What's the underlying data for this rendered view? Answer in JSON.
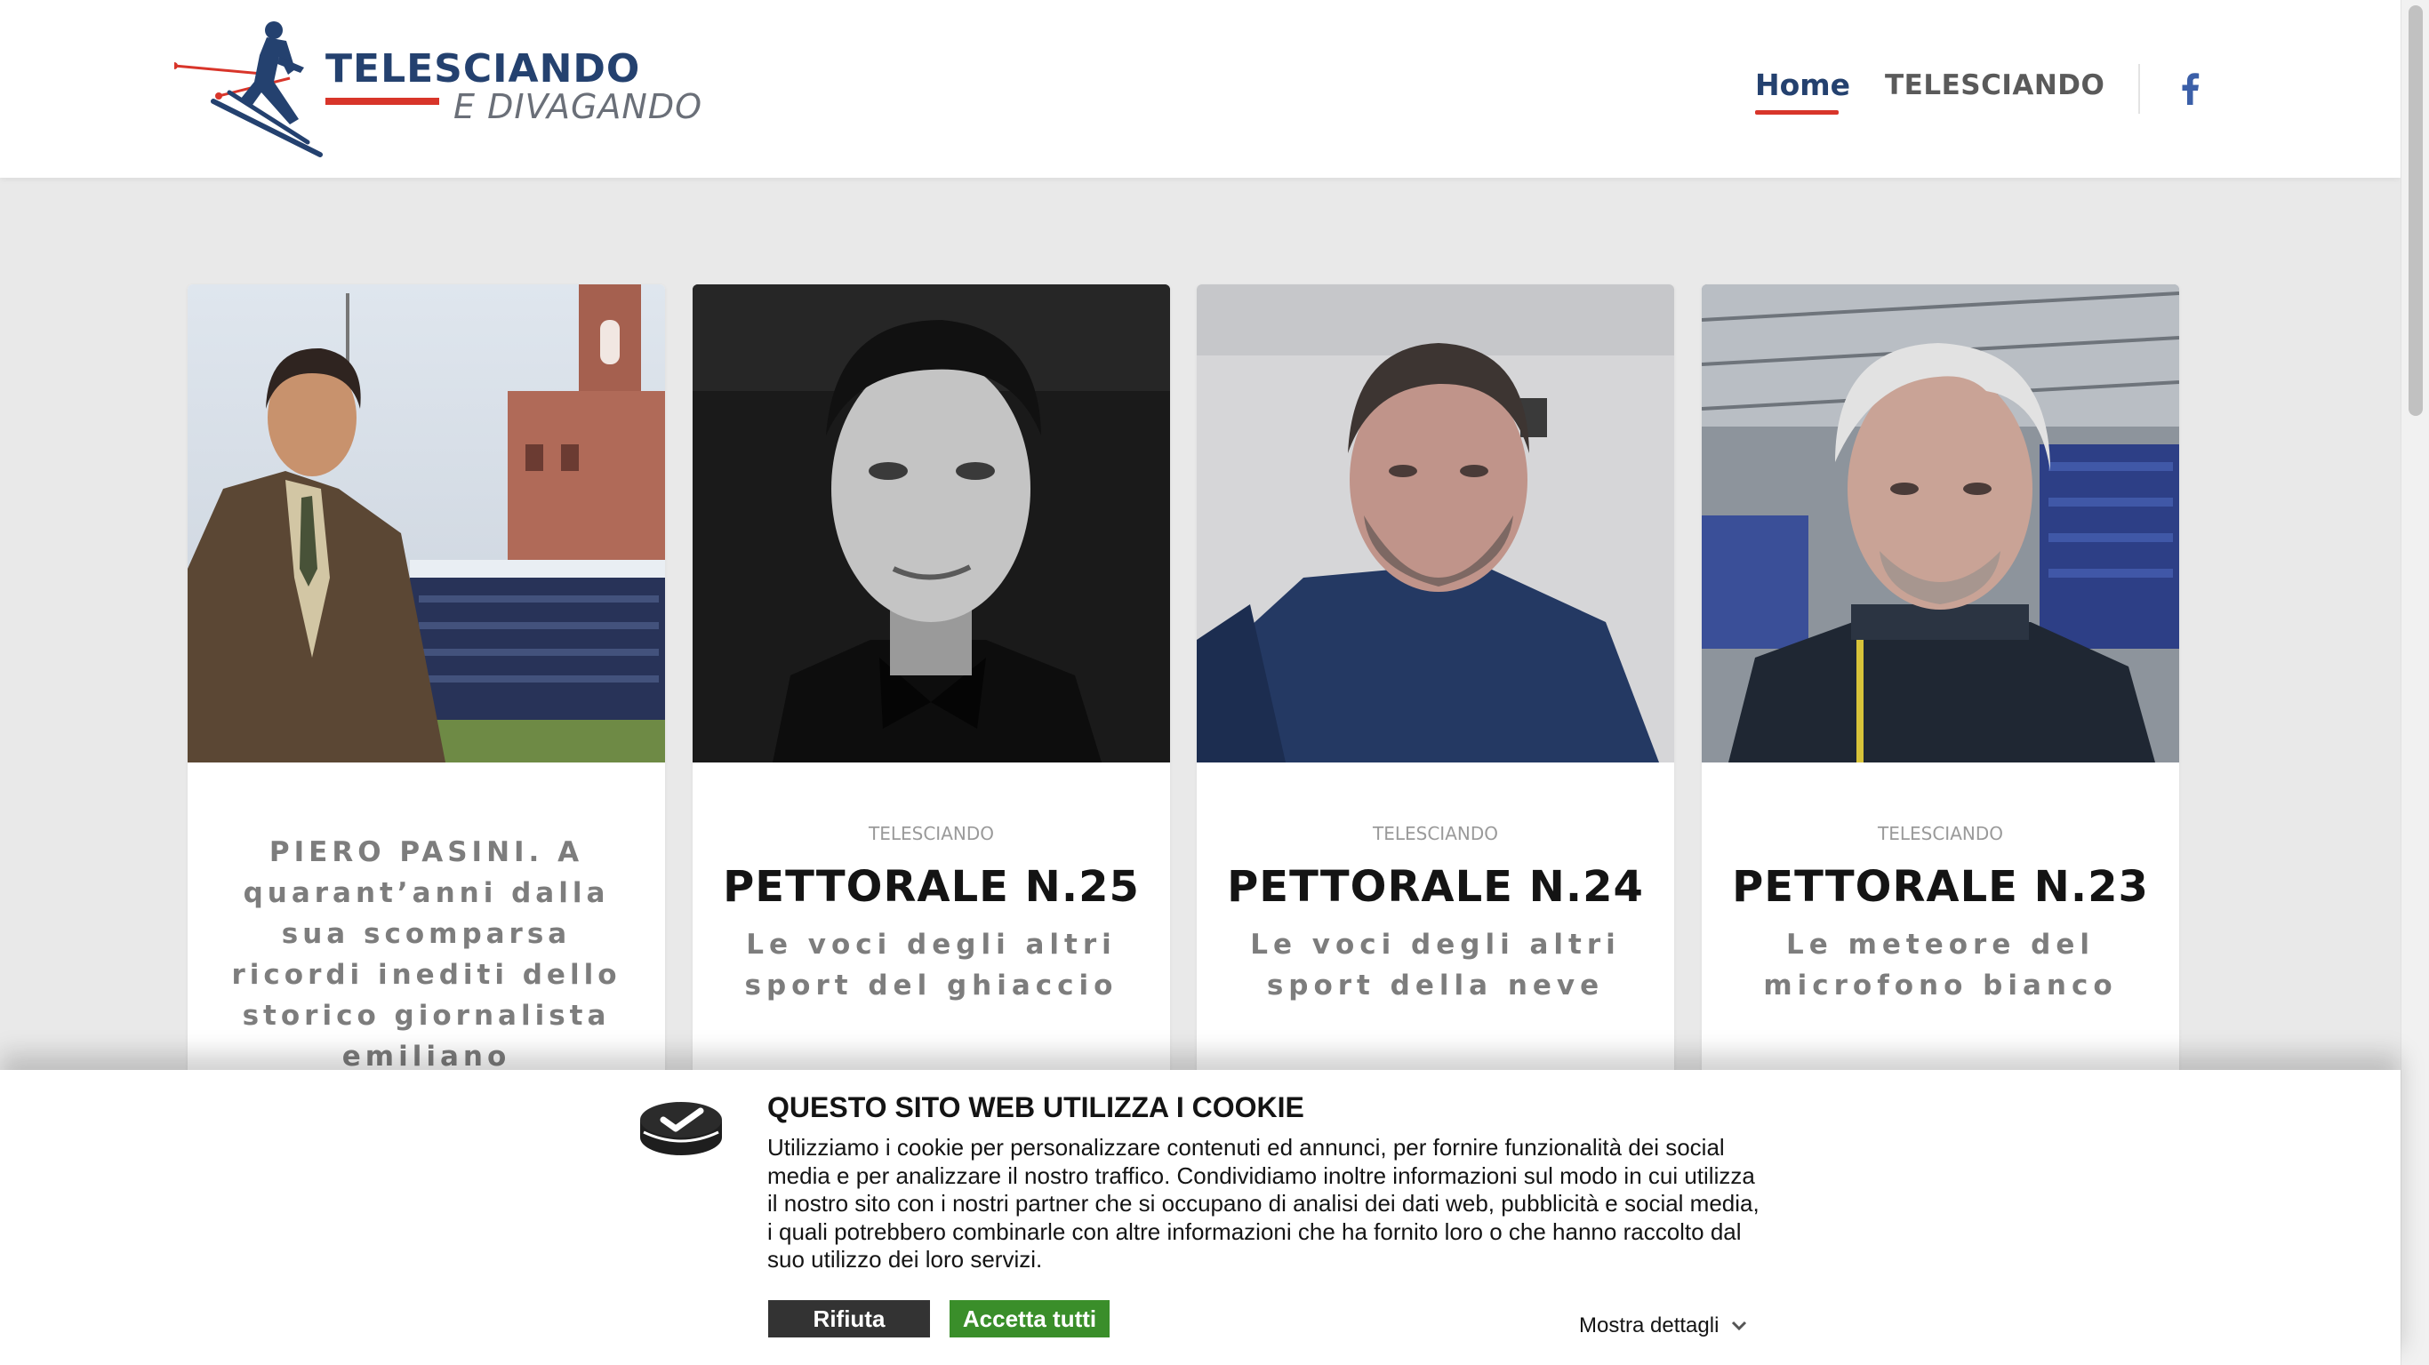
{
  "header": {
    "logo_title": "TELESCIANDO",
    "logo_subtitle": "E DIVAGANDO",
    "nav": [
      {
        "label": "Home",
        "active": true
      },
      {
        "label": "TELESCIANDO",
        "active": false
      }
    ],
    "social_icon": "facebook-icon"
  },
  "cards": [
    {
      "category": "",
      "title": "",
      "subtitle": "PIERO PASINI. A quarant’anni dalla sua scomparsa ricordi inediti dello storico giornalista emiliano",
      "image": "tv-presenter-in-stadium-photo"
    },
    {
      "category": "TELESCIANDO",
      "title": "PETTORALE N.25",
      "subtitle": "Le voci degli altri sport del ghiaccio",
      "image": "black-and-white-portrait-photo"
    },
    {
      "category": "TELESCIANDO",
      "title": "PETTORALE N.24",
      "subtitle": "Le voci degli altri sport della neve",
      "image": "webcam-portrait-photo"
    },
    {
      "category": "TELESCIANDO",
      "title": "PETTORALE N.23",
      "subtitle": "Le meteore del microfono bianco",
      "image": "stadium-selfie-photo"
    }
  ],
  "cookie_banner": {
    "title": "QUESTO SITO WEB UTILIZZA I COOKIE",
    "text": "Utilizziamo i cookie per personalizzare contenuti ed annunci, per fornire funzionalità dei social media e per analizzare il nostro traffico. Condividiamo inoltre informazioni sul modo in cui utilizza il nostro sito con i nostri partner che si occupano di analisi dei dati web, pubblicità e social media, i quali potrebbero combinarle con altre informazioni che ha fornito loro o che hanno raccolto dal suo utilizzo dei loro servizi.",
    "reject_label": "Rifiuta",
    "accept_label": "Accetta tutti",
    "details_label": "Mostra dettagli",
    "colors": {
      "reject": "#333333",
      "accept": "#3a8e2a"
    }
  },
  "colors": {
    "brand_blue": "#24416f",
    "brand_red": "#d8352a",
    "page_bg": "#e9e9e9"
  }
}
